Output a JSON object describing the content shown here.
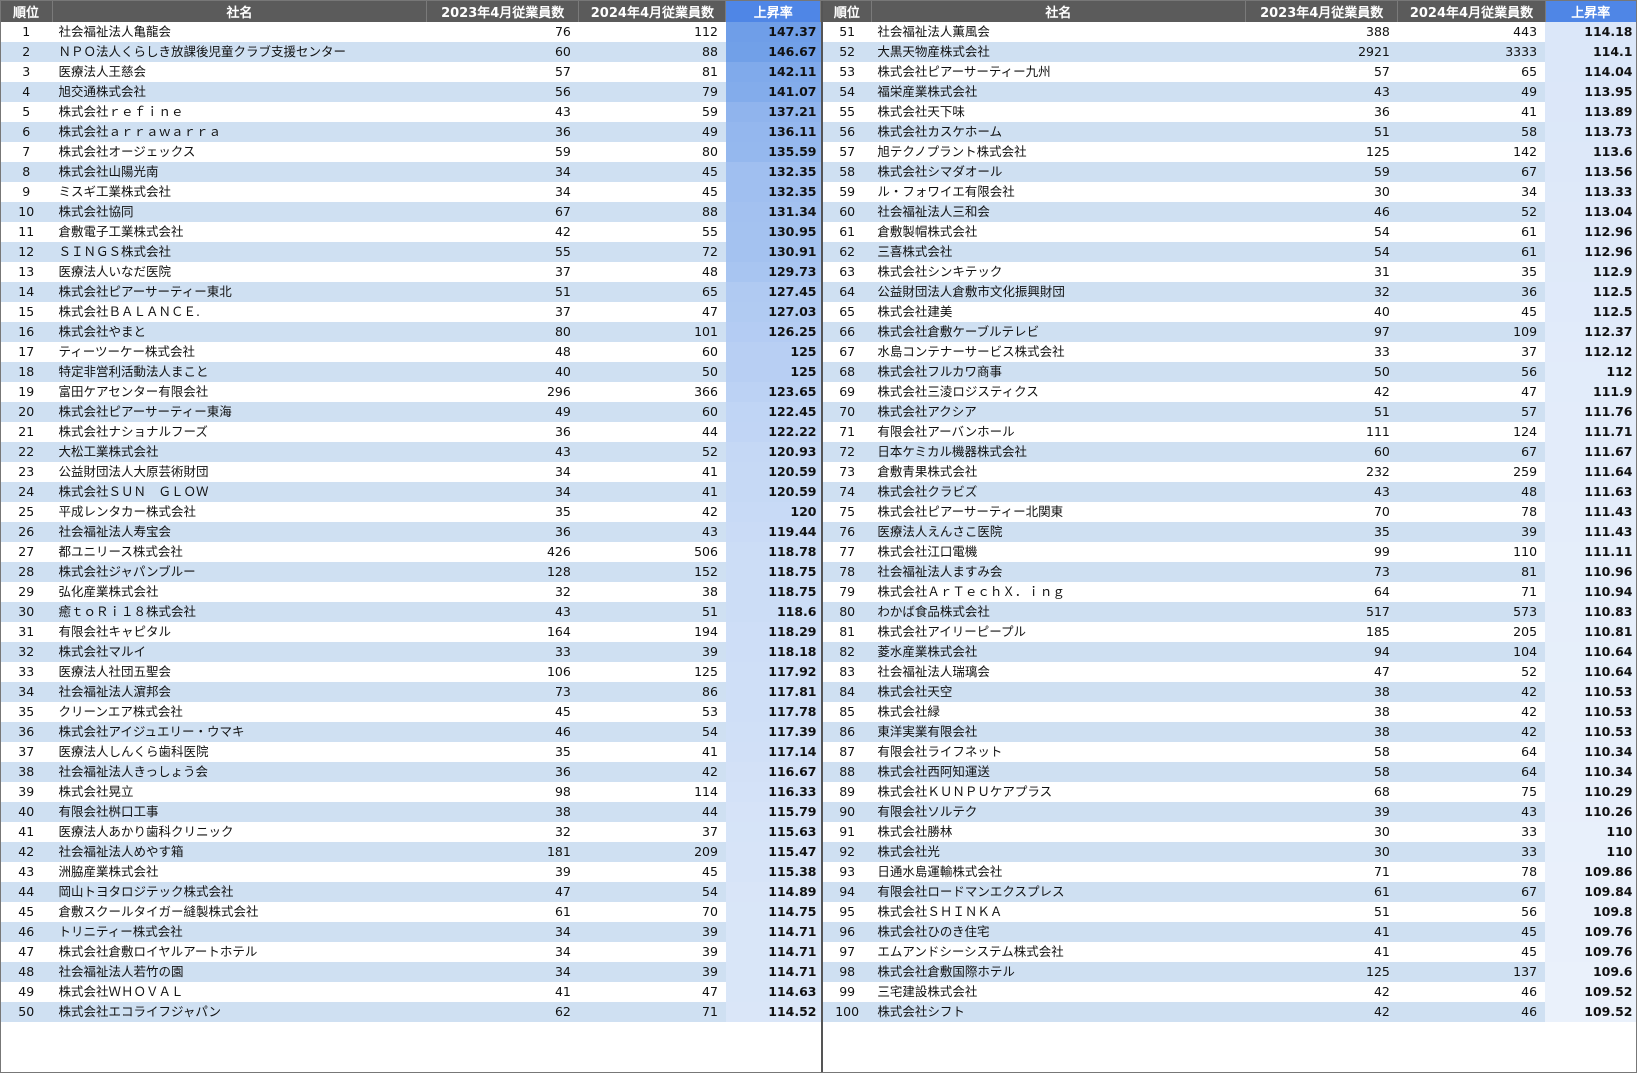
{
  "headers": {
    "rank": "順位",
    "name": "社名",
    "employees_2023": "2023年4月従業員数",
    "employees_2024": "2024年4月従業員数",
    "rate": "上昇率"
  },
  "colors": {
    "header_bg": "#5b5b5b",
    "header_rate_bg": "#4f86e6",
    "stripe": "#cfe0f2",
    "rate_bar_strong": "#6f9ee8",
    "rate_bar_light": "#eaf1fb"
  },
  "rows": [
    {
      "rank": "1",
      "name": "社会福祉法人亀龍会",
      "y2023": "76",
      "y2024": "112",
      "rate": "147.37"
    },
    {
      "rank": "2",
      "name": "ＮＰＯ法人くらしき放課後児童クラブ支援センター",
      "y2023": "60",
      "y2024": "88",
      "rate": "146.67"
    },
    {
      "rank": "3",
      "name": "医療法人王慈会",
      "y2023": "57",
      "y2024": "81",
      "rate": "142.11"
    },
    {
      "rank": "4",
      "name": "旭交通株式会社",
      "y2023": "56",
      "y2024": "79",
      "rate": "141.07"
    },
    {
      "rank": "5",
      "name": "株式会社ｒｅｆｉｎｅ",
      "y2023": "43",
      "y2024": "59",
      "rate": "137.21"
    },
    {
      "rank": "6",
      "name": "株式会社ａｒｒａｗａｒｒａ",
      "y2023": "36",
      "y2024": "49",
      "rate": "136.11"
    },
    {
      "rank": "7",
      "name": "株式会社オージェックス",
      "y2023": "59",
      "y2024": "80",
      "rate": "135.59"
    },
    {
      "rank": "8",
      "name": "株式会社山陽光南",
      "y2023": "34",
      "y2024": "45",
      "rate": "132.35"
    },
    {
      "rank": "9",
      "name": "ミスギ工業株式会社",
      "y2023": "34",
      "y2024": "45",
      "rate": "132.35"
    },
    {
      "rank": "10",
      "name": "株式会社協同",
      "y2023": "67",
      "y2024": "88",
      "rate": "131.34"
    },
    {
      "rank": "11",
      "name": "倉敷電子工業株式会社",
      "y2023": "42",
      "y2024": "55",
      "rate": "130.95"
    },
    {
      "rank": "12",
      "name": "ＳＩＮＧＳ株式会社",
      "y2023": "55",
      "y2024": "72",
      "rate": "130.91"
    },
    {
      "rank": "13",
      "name": "医療法人いなだ医院",
      "y2023": "37",
      "y2024": "48",
      "rate": "129.73"
    },
    {
      "rank": "14",
      "name": "株式会社ピアーサーティー東北",
      "y2023": "51",
      "y2024": "65",
      "rate": "127.45"
    },
    {
      "rank": "15",
      "name": "株式会社ＢＡＬＡＮＣＥ.",
      "y2023": "37",
      "y2024": "47",
      "rate": "127.03"
    },
    {
      "rank": "16",
      "name": "株式会社やまと",
      "y2023": "80",
      "y2024": "101",
      "rate": "126.25"
    },
    {
      "rank": "17",
      "name": "ティーツーケー株式会社",
      "y2023": "48",
      "y2024": "60",
      "rate": "125"
    },
    {
      "rank": "18",
      "name": "特定非営利活動法人まこと",
      "y2023": "40",
      "y2024": "50",
      "rate": "125"
    },
    {
      "rank": "19",
      "name": "富田ケアセンター有限会社",
      "y2023": "296",
      "y2024": "366",
      "rate": "123.65"
    },
    {
      "rank": "20",
      "name": "株式会社ピアーサーティー東海",
      "y2023": "49",
      "y2024": "60",
      "rate": "122.45"
    },
    {
      "rank": "21",
      "name": "株式会社ナショナルフーズ",
      "y2023": "36",
      "y2024": "44",
      "rate": "122.22"
    },
    {
      "rank": "22",
      "name": "大松工業株式会社",
      "y2023": "43",
      "y2024": "52",
      "rate": "120.93"
    },
    {
      "rank": "23",
      "name": "公益財団法人大原芸術財団",
      "y2023": "34",
      "y2024": "41",
      "rate": "120.59"
    },
    {
      "rank": "24",
      "name": "株式会社ＳＵＮ　ＧＬＯＷ",
      "y2023": "34",
      "y2024": "41",
      "rate": "120.59"
    },
    {
      "rank": "25",
      "name": "平成レンタカー株式会社",
      "y2023": "35",
      "y2024": "42",
      "rate": "120"
    },
    {
      "rank": "26",
      "name": "社会福祉法人寿宝会",
      "y2023": "36",
      "y2024": "43",
      "rate": "119.44"
    },
    {
      "rank": "27",
      "name": "都ユニリース株式会社",
      "y2023": "426",
      "y2024": "506",
      "rate": "118.78"
    },
    {
      "rank": "28",
      "name": "株式会社ジャパンブルー",
      "y2023": "128",
      "y2024": "152",
      "rate": "118.75"
    },
    {
      "rank": "29",
      "name": "弘化産業株式会社",
      "y2023": "32",
      "y2024": "38",
      "rate": "118.75"
    },
    {
      "rank": "30",
      "name": "癒ｔｏＲｉ１８株式会社",
      "y2023": "43",
      "y2024": "51",
      "rate": "118.6"
    },
    {
      "rank": "31",
      "name": "有限会社キャピタル",
      "y2023": "164",
      "y2024": "194",
      "rate": "118.29"
    },
    {
      "rank": "32",
      "name": "株式会社マルイ",
      "y2023": "33",
      "y2024": "39",
      "rate": "118.18"
    },
    {
      "rank": "33",
      "name": "医療法人社団五聖会",
      "y2023": "106",
      "y2024": "125",
      "rate": "117.92"
    },
    {
      "rank": "34",
      "name": "社会福祉法人濵邦会",
      "y2023": "73",
      "y2024": "86",
      "rate": "117.81"
    },
    {
      "rank": "35",
      "name": "クリーンエア株式会社",
      "y2023": "45",
      "y2024": "53",
      "rate": "117.78"
    },
    {
      "rank": "36",
      "name": "株式会社アイジュエリー・ウマキ",
      "y2023": "46",
      "y2024": "54",
      "rate": "117.39"
    },
    {
      "rank": "37",
      "name": "医療法人しんくら歯科医院",
      "y2023": "35",
      "y2024": "41",
      "rate": "117.14"
    },
    {
      "rank": "38",
      "name": "社会福祉法人きっしょう会",
      "y2023": "36",
      "y2024": "42",
      "rate": "116.67"
    },
    {
      "rank": "39",
      "name": "株式会社晃立",
      "y2023": "98",
      "y2024": "114",
      "rate": "116.33"
    },
    {
      "rank": "40",
      "name": "有限会社桝口工事",
      "y2023": "38",
      "y2024": "44",
      "rate": "115.79"
    },
    {
      "rank": "41",
      "name": "医療法人あかり歯科クリニック",
      "y2023": "32",
      "y2024": "37",
      "rate": "115.63"
    },
    {
      "rank": "42",
      "name": "社会福祉法人めやす箱",
      "y2023": "181",
      "y2024": "209",
      "rate": "115.47"
    },
    {
      "rank": "43",
      "name": "洲脇産業株式会社",
      "y2023": "39",
      "y2024": "45",
      "rate": "115.38"
    },
    {
      "rank": "44",
      "name": "岡山トヨタロジテック株式会社",
      "y2023": "47",
      "y2024": "54",
      "rate": "114.89"
    },
    {
      "rank": "45",
      "name": "倉敷スクールタイガー縫製株式会社",
      "y2023": "61",
      "y2024": "70",
      "rate": "114.75"
    },
    {
      "rank": "46",
      "name": "トリニティー株式会社",
      "y2023": "34",
      "y2024": "39",
      "rate": "114.71"
    },
    {
      "rank": "47",
      "name": "株式会社倉敷ロイヤルアートホテル",
      "y2023": "34",
      "y2024": "39",
      "rate": "114.71"
    },
    {
      "rank": "48",
      "name": "社会福祉法人若竹の園",
      "y2023": "34",
      "y2024": "39",
      "rate": "114.71"
    },
    {
      "rank": "49",
      "name": "株式会社ＷＨＯＶＡＬ",
      "y2023": "41",
      "y2024": "47",
      "rate": "114.63"
    },
    {
      "rank": "50",
      "name": "株式会社エコライフジャパン",
      "y2023": "62",
      "y2024": "71",
      "rate": "114.52"
    },
    {
      "rank": "51",
      "name": "社会福祉法人薫風会",
      "y2023": "388",
      "y2024": "443",
      "rate": "114.18"
    },
    {
      "rank": "52",
      "name": "大黒天物産株式会社",
      "y2023": "2921",
      "y2024": "3333",
      "rate": "114.1"
    },
    {
      "rank": "53",
      "name": "株式会社ピアーサーティー九州",
      "y2023": "57",
      "y2024": "65",
      "rate": "114.04"
    },
    {
      "rank": "54",
      "name": "福栄産業株式会社",
      "y2023": "43",
      "y2024": "49",
      "rate": "113.95"
    },
    {
      "rank": "55",
      "name": "株式会社天下味",
      "y2023": "36",
      "y2024": "41",
      "rate": "113.89"
    },
    {
      "rank": "56",
      "name": "株式会社カスケホーム",
      "y2023": "51",
      "y2024": "58",
      "rate": "113.73"
    },
    {
      "rank": "57",
      "name": "旭テクノプラント株式会社",
      "y2023": "125",
      "y2024": "142",
      "rate": "113.6"
    },
    {
      "rank": "58",
      "name": "株式会社シマダオール",
      "y2023": "59",
      "y2024": "67",
      "rate": "113.56"
    },
    {
      "rank": "59",
      "name": "ル・フォワイエ有限会社",
      "y2023": "30",
      "y2024": "34",
      "rate": "113.33"
    },
    {
      "rank": "60",
      "name": "社会福祉法人三和会",
      "y2023": "46",
      "y2024": "52",
      "rate": "113.04"
    },
    {
      "rank": "61",
      "name": "倉敷製帽株式会社",
      "y2023": "54",
      "y2024": "61",
      "rate": "112.96"
    },
    {
      "rank": "62",
      "name": "三喜株式会社",
      "y2023": "54",
      "y2024": "61",
      "rate": "112.96"
    },
    {
      "rank": "63",
      "name": "株式会社シンキテック",
      "y2023": "31",
      "y2024": "35",
      "rate": "112.9"
    },
    {
      "rank": "64",
      "name": "公益財団法人倉敷市文化振興財団",
      "y2023": "32",
      "y2024": "36",
      "rate": "112.5"
    },
    {
      "rank": "65",
      "name": "株式会社建美",
      "y2023": "40",
      "y2024": "45",
      "rate": "112.5"
    },
    {
      "rank": "66",
      "name": "株式会社倉敷ケーブルテレビ",
      "y2023": "97",
      "y2024": "109",
      "rate": "112.37"
    },
    {
      "rank": "67",
      "name": "水島コンテナーサービス株式会社",
      "y2023": "33",
      "y2024": "37",
      "rate": "112.12"
    },
    {
      "rank": "68",
      "name": "株式会社フルカワ商事",
      "y2023": "50",
      "y2024": "56",
      "rate": "112"
    },
    {
      "rank": "69",
      "name": "株式会社三淩ロジスティクス",
      "y2023": "42",
      "y2024": "47",
      "rate": "111.9"
    },
    {
      "rank": "70",
      "name": "株式会社アクシア",
      "y2023": "51",
      "y2024": "57",
      "rate": "111.76"
    },
    {
      "rank": "71",
      "name": "有限会社アーバンホール",
      "y2023": "111",
      "y2024": "124",
      "rate": "111.71"
    },
    {
      "rank": "72",
      "name": "日本ケミカル機器株式会社",
      "y2023": "60",
      "y2024": "67",
      "rate": "111.67"
    },
    {
      "rank": "73",
      "name": "倉敷青果株式会社",
      "y2023": "232",
      "y2024": "259",
      "rate": "111.64"
    },
    {
      "rank": "74",
      "name": "株式会社クラビズ",
      "y2023": "43",
      "y2024": "48",
      "rate": "111.63"
    },
    {
      "rank": "75",
      "name": "株式会社ピアーサーティー北関東",
      "y2023": "70",
      "y2024": "78",
      "rate": "111.43"
    },
    {
      "rank": "76",
      "name": "医療法人えんさこ医院",
      "y2023": "35",
      "y2024": "39",
      "rate": "111.43"
    },
    {
      "rank": "77",
      "name": "株式会社江口電機",
      "y2023": "99",
      "y2024": "110",
      "rate": "111.11"
    },
    {
      "rank": "78",
      "name": "社会福祉法人ますみ会",
      "y2023": "73",
      "y2024": "81",
      "rate": "110.96"
    },
    {
      "rank": "79",
      "name": "株式会社ＡｒＴｅｃｈＸ．ｉｎｇ",
      "y2023": "64",
      "y2024": "71",
      "rate": "110.94"
    },
    {
      "rank": "80",
      "name": "わかば食品株式会社",
      "y2023": "517",
      "y2024": "573",
      "rate": "110.83"
    },
    {
      "rank": "81",
      "name": "株式会社アイリーピープル",
      "y2023": "185",
      "y2024": "205",
      "rate": "110.81"
    },
    {
      "rank": "82",
      "name": "菱水産業株式会社",
      "y2023": "94",
      "y2024": "104",
      "rate": "110.64"
    },
    {
      "rank": "83",
      "name": "社会福祉法人瑞璃会",
      "y2023": "47",
      "y2024": "52",
      "rate": "110.64"
    },
    {
      "rank": "84",
      "name": "株式会社天空",
      "y2023": "38",
      "y2024": "42",
      "rate": "110.53"
    },
    {
      "rank": "85",
      "name": "株式会社緑",
      "y2023": "38",
      "y2024": "42",
      "rate": "110.53"
    },
    {
      "rank": "86",
      "name": "東洋実業有限会社",
      "y2023": "38",
      "y2024": "42",
      "rate": "110.53"
    },
    {
      "rank": "87",
      "name": "有限会社ライフネット",
      "y2023": "58",
      "y2024": "64",
      "rate": "110.34"
    },
    {
      "rank": "88",
      "name": "株式会社西阿知運送",
      "y2023": "58",
      "y2024": "64",
      "rate": "110.34"
    },
    {
      "rank": "89",
      "name": "株式会社ＫＵＮＰＵケアプラス",
      "y2023": "68",
      "y2024": "75",
      "rate": "110.29"
    },
    {
      "rank": "90",
      "name": "有限会社ソルテク",
      "y2023": "39",
      "y2024": "43",
      "rate": "110.26"
    },
    {
      "rank": "91",
      "name": "株式会社勝林",
      "y2023": "30",
      "y2024": "33",
      "rate": "110"
    },
    {
      "rank": "92",
      "name": "株式会社光",
      "y2023": "30",
      "y2024": "33",
      "rate": "110"
    },
    {
      "rank": "93",
      "name": "日通水島運輸株式会社",
      "y2023": "71",
      "y2024": "78",
      "rate": "109.86"
    },
    {
      "rank": "94",
      "name": "有限会社ロードマンエクスプレス",
      "y2023": "61",
      "y2024": "67",
      "rate": "109.84"
    },
    {
      "rank": "95",
      "name": "株式会社ＳＨＩＮＫＡ",
      "y2023": "51",
      "y2024": "56",
      "rate": "109.8"
    },
    {
      "rank": "96",
      "name": "株式会社ひのき住宅",
      "y2023": "41",
      "y2024": "45",
      "rate": "109.76"
    },
    {
      "rank": "97",
      "name": "エムアンドシーシステム株式会社",
      "y2023": "41",
      "y2024": "45",
      "rate": "109.76"
    },
    {
      "rank": "98",
      "name": "株式会社倉敷国際ホテル",
      "y2023": "125",
      "y2024": "137",
      "rate": "109.6"
    },
    {
      "rank": "99",
      "name": "三宅建設株式会社",
      "y2023": "42",
      "y2024": "46",
      "rate": "109.52"
    },
    {
      "rank": "100",
      "name": "株式会社シフト",
      "y2023": "42",
      "y2024": "46",
      "rate": "109.52"
    }
  ]
}
